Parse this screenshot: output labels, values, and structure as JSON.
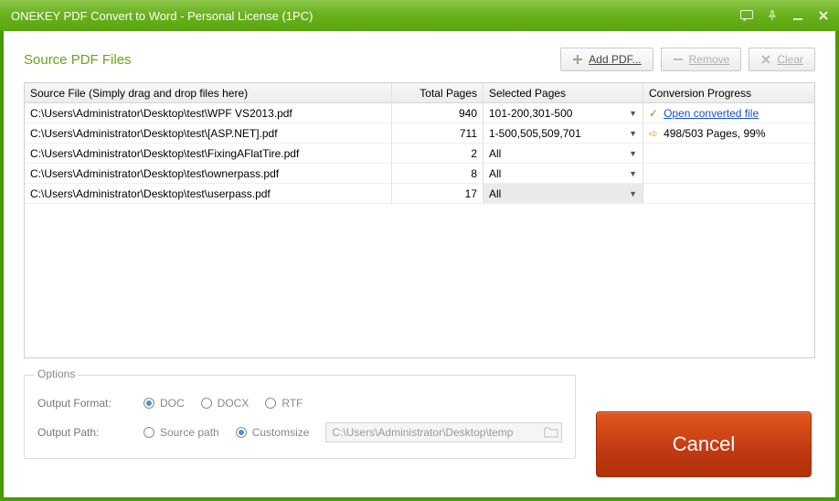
{
  "titlebar": {
    "title": "ONEKEY PDF Convert to Word - Personal License (1PC)"
  },
  "section": {
    "title": "Source PDF Files"
  },
  "toolbar": {
    "add_label": "Add PDF...",
    "remove_label": "Remove",
    "clear_label": "Clear"
  },
  "grid": {
    "headers": {
      "source": "Source File (Simply drag and drop files here)",
      "total": "Total Pages",
      "selected": "Selected Pages",
      "progress": "Conversion Progress"
    },
    "rows": [
      {
        "source": "C:\\Users\\Administrator\\Desktop\\test\\WPF VS2013.pdf",
        "total": "940",
        "selected": "101-200,301-500",
        "progress_type": "done",
        "progress_text": "Open converted file"
      },
      {
        "source": "C:\\Users\\Administrator\\Desktop\\test\\[ASP.NET].pdf",
        "total": "711",
        "selected": "1-500,505,509,701",
        "progress_type": "running",
        "progress_text": "498/503 Pages, 99%"
      },
      {
        "source": "C:\\Users\\Administrator\\Desktop\\test\\FixingAFlatTire.pdf",
        "total": "2",
        "selected": "All",
        "progress_type": "",
        "progress_text": ""
      },
      {
        "source": "C:\\Users\\Administrator\\Desktop\\test\\ownerpass.pdf",
        "total": "8",
        "selected": "All",
        "progress_type": "",
        "progress_text": ""
      },
      {
        "source": "C:\\Users\\Administrator\\Desktop\\test\\userpass.pdf",
        "total": "17",
        "selected": "All",
        "progress_type": "",
        "progress_text": ""
      }
    ]
  },
  "options": {
    "legend": "Options",
    "format_label": "Output Format:",
    "formats": {
      "doc": "DOC",
      "docx": "DOCX",
      "rtf": "RTF"
    },
    "format_selected": "doc",
    "path_label": "Output Path:",
    "path_modes": {
      "source": "Source path",
      "custom": "Customsize"
    },
    "path_mode_selected": "custom",
    "path_value": "C:\\Users\\Administrator\\Desktop\\temp"
  },
  "action": {
    "cancel": "Cancel"
  }
}
